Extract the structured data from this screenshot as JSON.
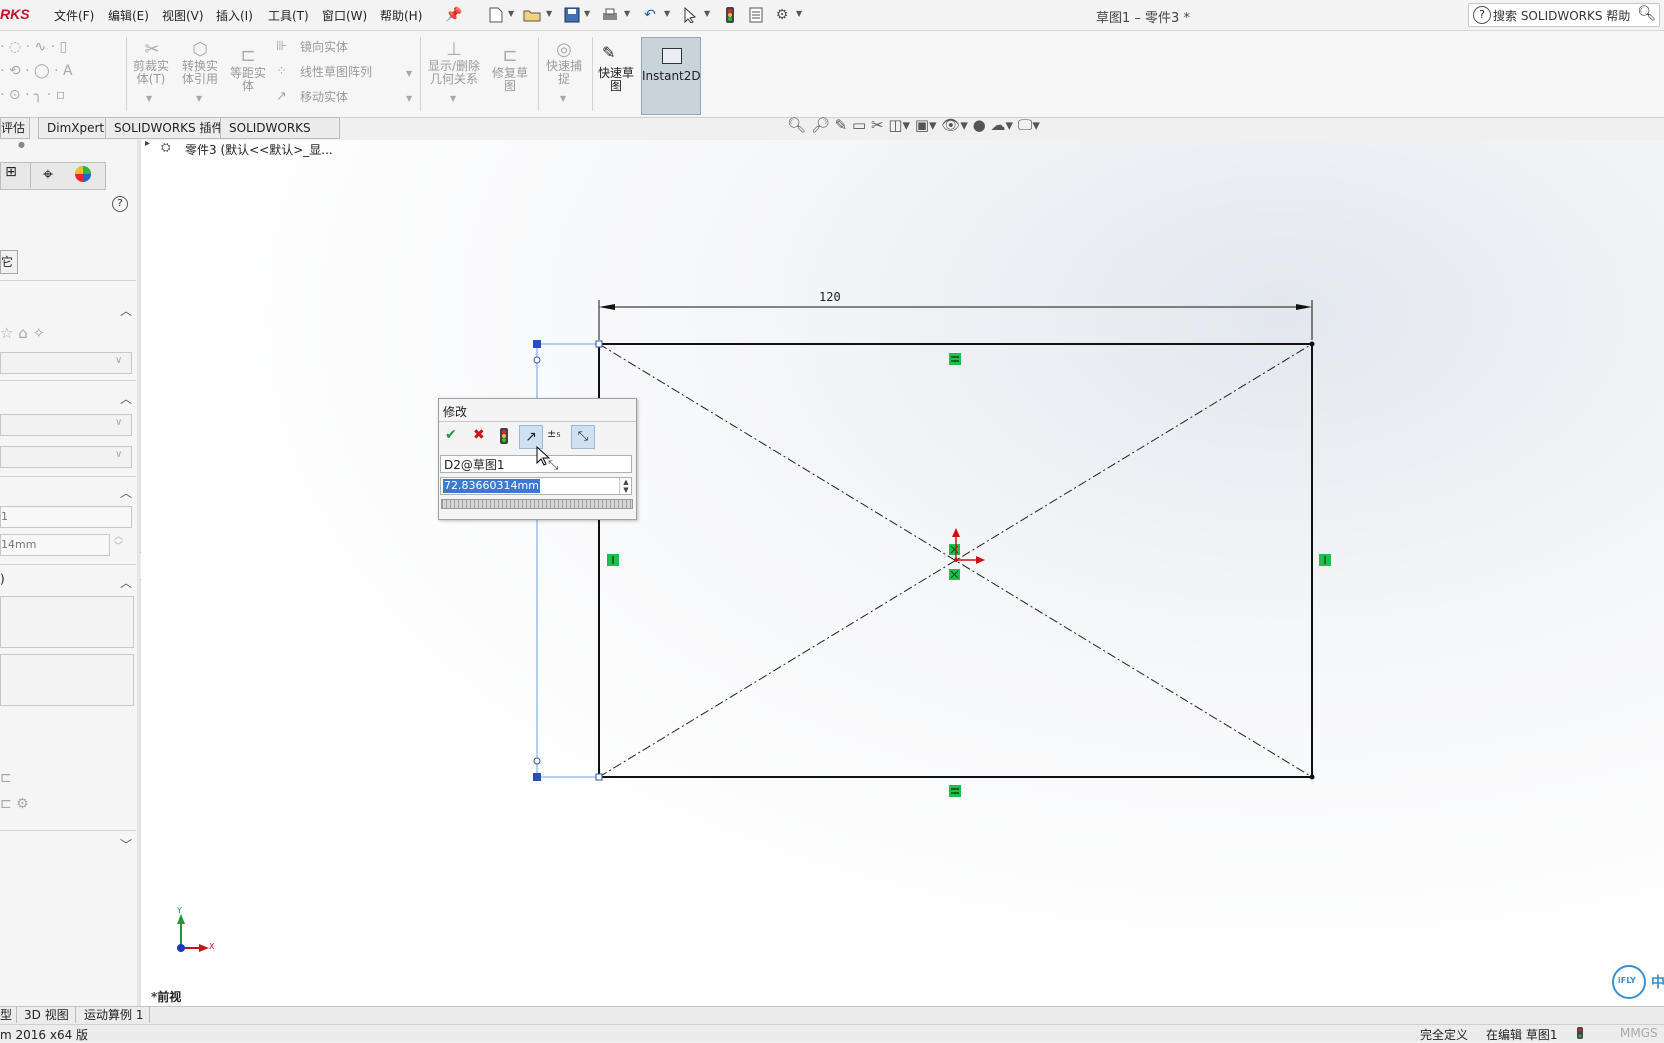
{
  "app": {
    "logo_text": "RKS",
    "doc_title": "草图1 – 零件3 *",
    "search_placeholder": "搜索 SOLIDWORKS 帮助"
  },
  "menu": [
    "文件(F)",
    "编辑(E)",
    "视图(V)",
    "插入(I)",
    "工具(T)",
    "窗口(W)",
    "帮助(H)"
  ],
  "command_manager": {
    "trim": "剪裁实\n体(T)",
    "convert": "转换实\n体引用",
    "offset": "等距实\n体",
    "mirror": "镜向实体",
    "linear_pattern": "线性草图阵列",
    "move": "移动实体",
    "relations": "显示/删除\n几何关系",
    "repair": "修复草\n图",
    "snap": "快速捕\n捉",
    "rapid_sketch": "快速草\n图",
    "instant2d": "Instant2D"
  },
  "tabs": [
    "评估",
    "DimXpert",
    "SOLIDWORKS 插件",
    "SOLIDWORKS MBD"
  ],
  "left_panel": {
    "tab_fragment": "它",
    "field_value_1": "1",
    "field_value_2": "14mm",
    "group_label": ")"
  },
  "feature_tree": {
    "item_label": "零件3  (默认<<默认>_显..."
  },
  "sketch": {
    "dimension_text": "120",
    "view_label": "*前视",
    "axis_x": "X",
    "axis_y": "Y"
  },
  "modify_dialog": {
    "title": "修改",
    "dimension_name": "D2@草图1",
    "value": "72.83660314mm"
  },
  "bottom_tabs": [
    "型",
    "3D 视图",
    "运动算例 1"
  ],
  "status": {
    "left": "m 2016 x64 版",
    "fully_defined": "完全定义",
    "editing": "在编辑 草图1",
    "units": "MMGS"
  },
  "watermark": {
    "text": "iFLY",
    "cjk": "中"
  },
  "colors": {
    "accent": "#1a7bd1",
    "relation_green": "#1fbf4f",
    "sketch_line": "#111111"
  }
}
